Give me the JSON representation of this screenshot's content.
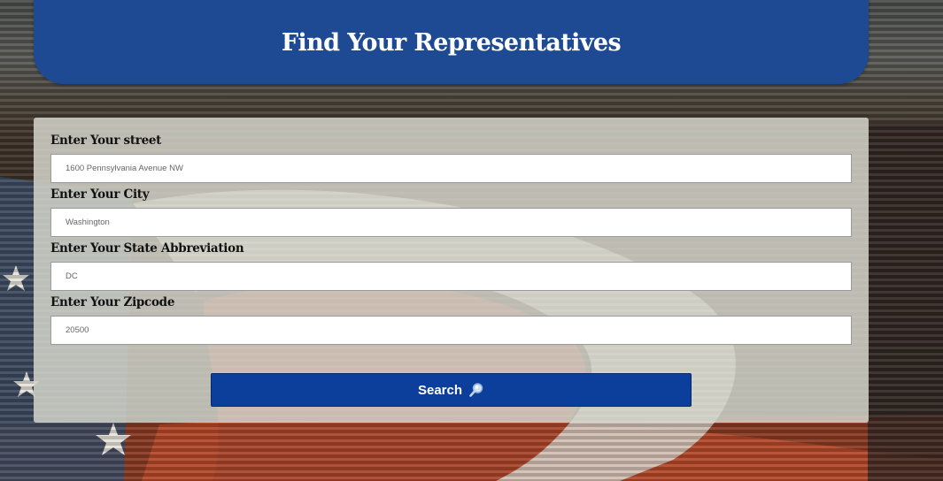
{
  "header": {
    "title": "Find Your Representatives"
  },
  "form": {
    "street": {
      "label": "Enter Your street",
      "placeholder": "1600 Pennsylvania Avenue NW"
    },
    "city": {
      "label": "Enter Your City",
      "placeholder": "Washington"
    },
    "state": {
      "label": "Enter Your State Abbreviation",
      "placeholder": "DC"
    },
    "zip": {
      "label": "Enter Your Zipcode",
      "placeholder": "20500"
    },
    "search_label": "Search",
    "search_icon": "magnifying-glass-icon"
  },
  "colors": {
    "header_bg": "#1d4a93",
    "button_bg": "#0c3f9c",
    "panel_bg": "#d7d7cd"
  }
}
